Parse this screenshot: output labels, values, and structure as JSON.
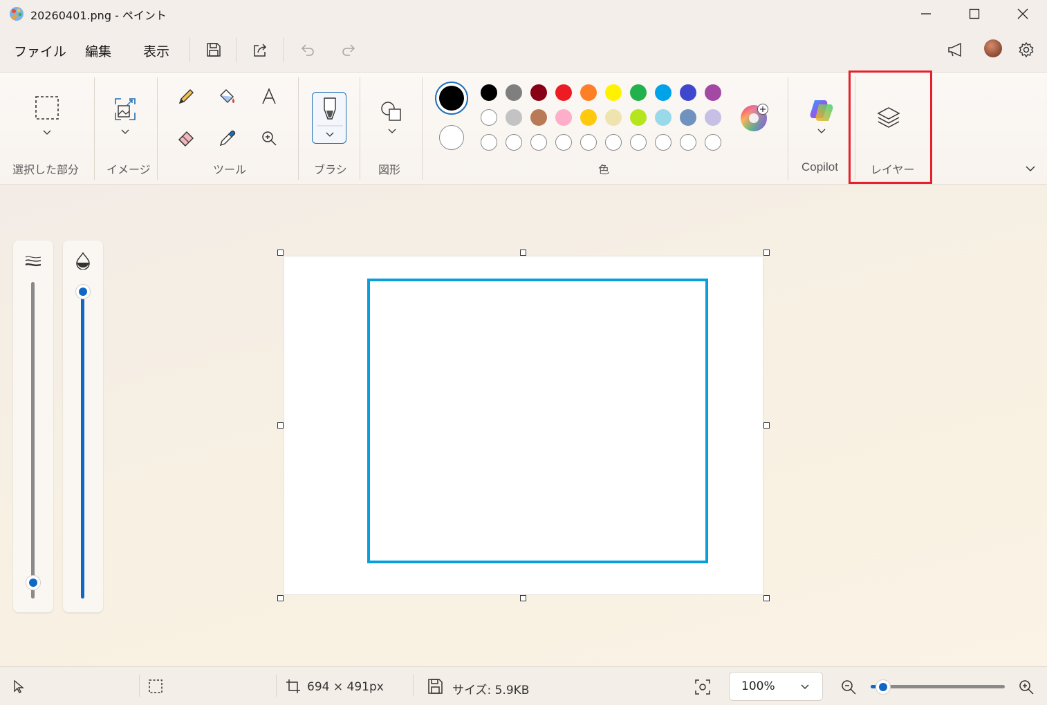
{
  "window": {
    "title": "20260401.png - ペイント",
    "minimize_icon": "minimize-icon",
    "maximize_icon": "maximize-icon",
    "close_icon": "close-icon"
  },
  "menu": {
    "file": "ファイル",
    "edit": "編集",
    "view": "表示"
  },
  "ribbon": {
    "groups": {
      "selection": "選択した部分",
      "image": "イメージ",
      "tools": "ツール",
      "brushes": "ブラシ",
      "shapes": "図形",
      "colors": "色",
      "copilot": "Copilot",
      "layers": "レイヤー"
    },
    "highlight_color": "#e5202a",
    "primary_color": "#000000",
    "secondary_color": "#ffffff",
    "palette_row1": [
      "#000000",
      "#7f7f7f",
      "#880015",
      "#ed1c24",
      "#ff7f27",
      "#fff200",
      "#22b14c",
      "#00a2e8",
      "#3f48cc",
      "#a349a4"
    ],
    "palette_row2": [
      "#ffffff",
      "#c3c3c3",
      "#b97a57",
      "#ffaec9",
      "#ffc90e",
      "#efe4b0",
      "#b5e61d",
      "#99d9ea",
      "#7092be",
      "#c8bfe7"
    ],
    "palette_row3_empty_count": 10
  },
  "canvas": {
    "stroke_color": "#0a9edc"
  },
  "sliders": {
    "size_level": 0.0,
    "opacity_level": 1.0
  },
  "status": {
    "dimensions": "694 × 491px",
    "size": "サイズ: 5.9KB",
    "zoom": "100%",
    "zoom_level": 0.05
  }
}
